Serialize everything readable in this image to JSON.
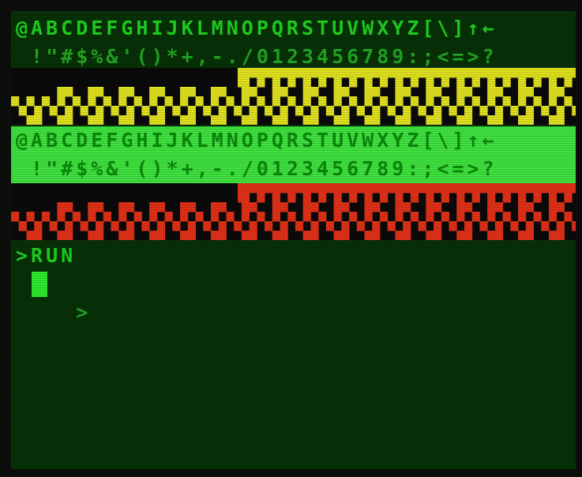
{
  "screen": {
    "charset_line1": "@ABCDEFGHIJKLMNOPQRSTUVWXYZ[\\]↑←",
    "charset_line2": " !\"#$%&'()*+,-./0123456789:;<=>?",
    "inverse_line1": "@ABCDEFGHIJKLMNOPQRSTUVWXYZ[\\]↑←",
    "inverse_line2": " !\"#$%&'()*+,-./0123456789:;<=>?",
    "prompt_line": ">RUN",
    "prompt_char": ">"
  },
  "colors": {
    "background": "#073107",
    "text": "#1fd01f",
    "inverse_bg": "#3fe03f",
    "yellow_block": "#e0e020",
    "red_block": "#e03018",
    "black_block": "#0a0a0a",
    "cursor": "#2ee82e"
  },
  "semigraphics": {
    "yellow_row": [
      "000000000000000000000000000000000000000000000000000000000001111111111111111111111111111111111111111111111111111111111111111111111111111111111111111",
      "0000000000000000000000000000000000000000000000000000000000011100110011001100110011001100110011001100110011001100110011001100110011001100110011001100",
      "0000000000001111000011110000111100001111000011110000111100001111000011110000111100001111000011110000111100001111000011110000111100001111000011110000",
      "1100110011001100110011001100110011001100110011001100110011001100110011001100110011001100110011001100110011001100110011001100110011001100110011001100",
      "0011001100110011001100110011001100110011001100110011001100110011001100110011001100110011001100110011001100110011001100110011001100110011001100110011",
      "0000111100001111000011110000111100001111000011110000111100001111000011110000111100001111000011110000111100001111000011110000111100001111000011110000"
    ]
  }
}
